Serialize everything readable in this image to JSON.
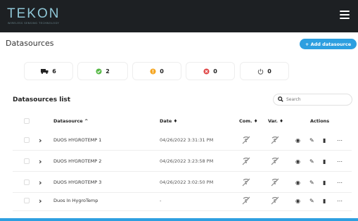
{
  "app": {
    "logo_text": "TEKON",
    "logo_sub": "WIRELESS SENSING TECHNOLOGY"
  },
  "header": {
    "title": "Datasources",
    "add_label": "+ Add datasource"
  },
  "stats": [
    {
      "icon": "truck-icon",
      "value": "6",
      "color": "#222222"
    },
    {
      "icon": "check-circle-icon",
      "value": "2",
      "color": "#58b947"
    },
    {
      "icon": "warning-circle-icon",
      "value": "0",
      "color": "#f5a623"
    },
    {
      "icon": "error-circle-icon",
      "value": "0",
      "color": "#e04848"
    },
    {
      "icon": "power-icon",
      "value": "0",
      "color": "#555555"
    }
  ],
  "list": {
    "title": "Datasources list",
    "search_placeholder": "Search",
    "columns": [
      "Datasource ^",
      "Date ♦",
      "Com. ♦",
      "Var. ♦",
      "Actions"
    ],
    "rows": [
      {
        "name": "DUOS HYGROTEMP 1",
        "date": "04/26/2022 3:31:31 PM"
      },
      {
        "name": "DUOS HYGROTEMP 2",
        "date": "04/26/2022 3:23:58 PM"
      },
      {
        "name": "DUOS HYGROTEMP 3",
        "date": "04/26/2022 3:02:50 PM"
      },
      {
        "name": "Duos In HygroTemp",
        "date": "-"
      }
    ]
  }
}
